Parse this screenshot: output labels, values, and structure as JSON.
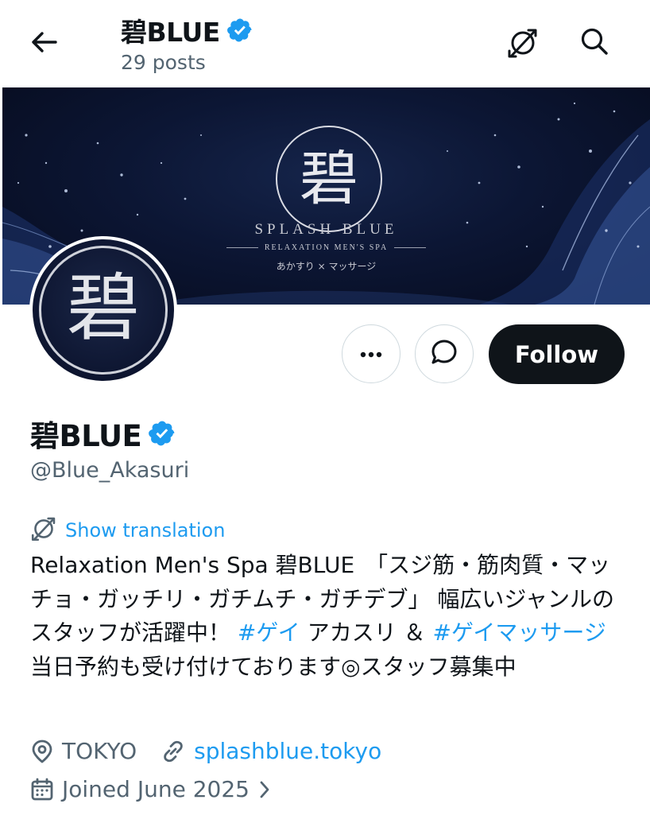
{
  "header": {
    "title": "碧BLUE",
    "post_count": "29 posts"
  },
  "banner": {
    "logo_char": "碧",
    "name": "SPLASH BLUE",
    "tagline": "RELAXATION MEN'S SPA",
    "subtitle": "あかすり × マッサージ"
  },
  "avatar": {
    "char": "碧"
  },
  "actions": {
    "follow_label": "Follow"
  },
  "profile": {
    "name": "碧BLUE",
    "handle": "@Blue_Akasuri",
    "show_translation": "Show translation",
    "bio": {
      "part1": "Relaxation Men's Spa 碧BLUE　「スジ筋・筋肉質・マッチョ・ガッチリ・ガチムチ・ガチデブ」 幅広いジャンルのスタッフが活躍中！ ",
      "hashtag1": "#ゲイ",
      "part2": " アカスリ ＆ ",
      "hashtag2": "#ゲイマッサージ",
      "part3": " 当日予約も受け付けております◎スタッフ募集中"
    },
    "location": "TOKYO",
    "website": "splashblue.tokyo",
    "joined": "Joined June 2025"
  },
  "colors": {
    "accent": "#1d9bf0",
    "text": "#0f1419",
    "secondary": "#536471",
    "follow_bg": "#0f1419"
  },
  "icons": {
    "back": "arrow-left-icon",
    "translate": "translate-icon",
    "search": "search-icon",
    "verified": "verified-badge-icon",
    "more": "more-icon",
    "message": "message-icon",
    "location": "location-pin-icon",
    "link": "link-icon",
    "calendar": "calendar-icon",
    "chevron": "chevron-right-icon"
  }
}
